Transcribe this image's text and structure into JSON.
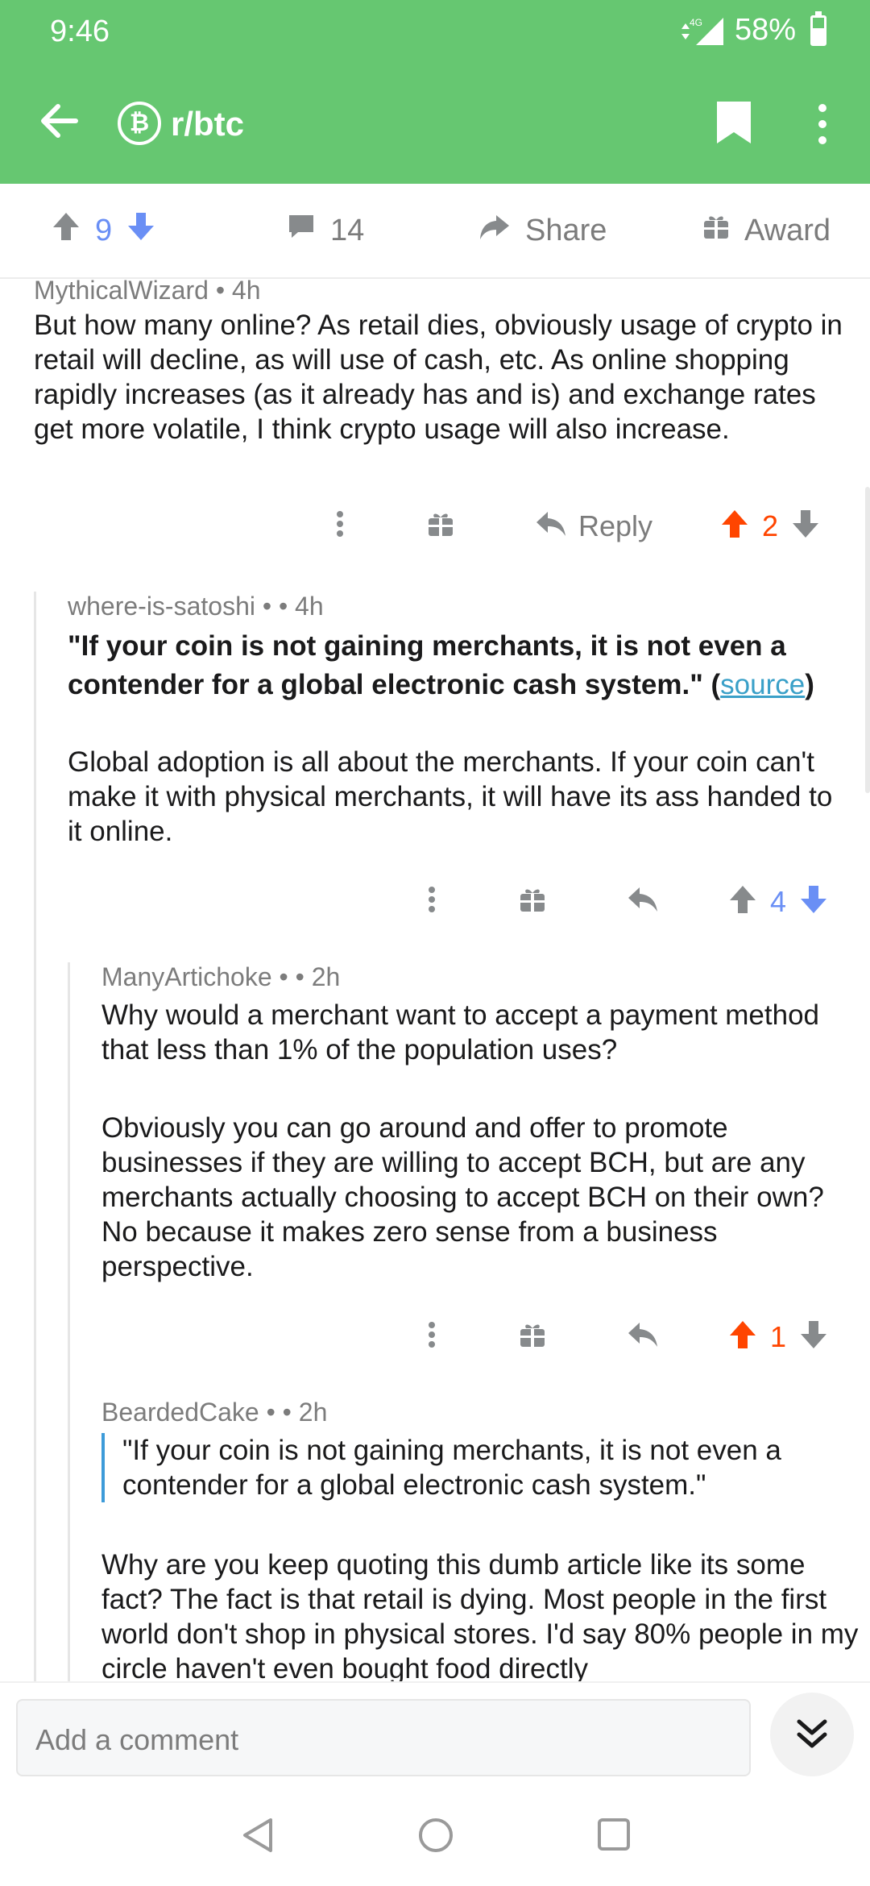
{
  "status_bar": {
    "time": "9:46",
    "network": "4G",
    "battery": "58%",
    "battery_level": 0.58
  },
  "header": {
    "back_icon": "arrow-left-icon",
    "subreddit": "r/btc",
    "subreddit_icon_glyph": "₿",
    "bookmark_icon": "bookmark-icon",
    "more_icon": "more-vertical-icon",
    "accent_color": "#66c771"
  },
  "post_actions": {
    "upvotes": "9",
    "comments": "14",
    "share_label": "Share",
    "award_label": "Award"
  },
  "comments": [
    {
      "author_cut": "MythicalWizard • 4h",
      "body": "But how many online? As retail dies, obviously usage of crypto in retail will decline, as will use of cash, etc. As online shopping rapidly increases (as it already has and is) and exchange rates get more volatile, I think crypto usage will also increase.",
      "reply_label": "Reply",
      "score": "2"
    },
    {
      "author": "where-is-satoshi •",
      "time": "• 4h",
      "quote": "\"If your coin is not gaining merchants, it is not even a contender for a global electronic cash system.\" (",
      "link": "source",
      "quote_end": ")",
      "body": "Global adoption is all about the merchants. If your coin can't make it with physical merchants, it will have its ass handed to it online.",
      "score": "4"
    },
    {
      "author": "ManyArtichoke •",
      "time": "• 2h",
      "body1": "Why would a merchant want to accept a payment method that less than 1% of the population uses?",
      "body2": "Obviously you can go around and offer to promote businesses if they are willing to accept BCH, but are any merchants actually choosing to accept BCH on their own? No because it makes zero sense from a business perspective.",
      "score": "1"
    },
    {
      "author": "BeardedCake •",
      "time": "• 2h",
      "quote": "\"If your coin is not gaining merchants, it is not even a contender for a global electronic cash system.\"",
      "body": "Why are you keep quoting this dumb article like its some fact? The fact is that retail is dying. Most people in the first world don't shop in physical stores. I'd say 80% people in my circle haven't even bought food directly"
    }
  ],
  "composer": {
    "placeholder": "Add a comment"
  }
}
